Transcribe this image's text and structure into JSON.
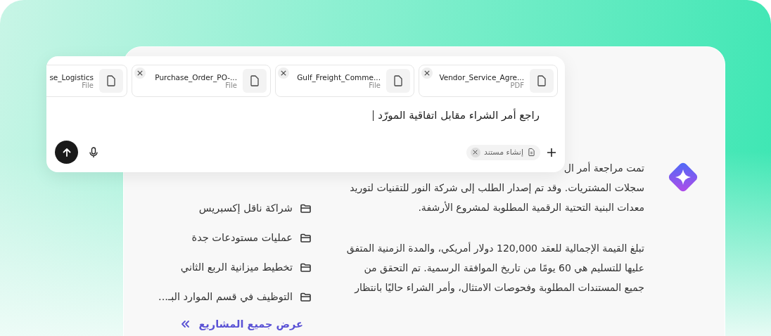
{
  "composer": {
    "attachments": [
      {
        "name": "Vendor_Service_Agre...",
        "type": "PDF",
        "remove_button": true
      },
      {
        "name": "Gulf_Freight_Comme...",
        "type": "File",
        "remove_button": true
      },
      {
        "name": "Purchase_Order_PO-...",
        "type": "File",
        "remove_button": true
      },
      {
        "name": "se_Logistics",
        "type": "File",
        "remove_button": false
      }
    ],
    "value": "راجع أمر الشراء مقابل اتفاقية المورّد",
    "tool_chip": {
      "label": "إنشاء مستند"
    }
  },
  "projects": {
    "items": [
      "شراكة ناقل إكسبريس",
      "عمليات مستودعات جدة",
      "تخطيط ميزانية الربع الثاني",
      "التوظيف في قسم الموارد البـ..."
    ],
    "view_all": "عرض جميع المشاريع"
  },
  "response": {
    "covered_line": "تمت مراجعة أمر ال",
    "paragraphs": [
      [
        "سجلات المشتريات. وقد تم إصدار الطلب إلى شركة النور للتقنيات لتوريد",
        "معدات البنية التحتية الرقمية المطلوبة لمشروع الأرشفة."
      ],
      [
        "تبلغ القيمة الإجمالية للعقد 120,000 دولار أمريكي، والمدة الزمنية المتفق",
        "عليها للتسليم هي 60 يومًا من تاريخ الموافقة الرسمية. تم التحقق من",
        "جميع المستندات المطلوبة وفحوصات الامتثال، وأمر الشراء حاليًا بانتظار"
      ]
    ]
  }
}
